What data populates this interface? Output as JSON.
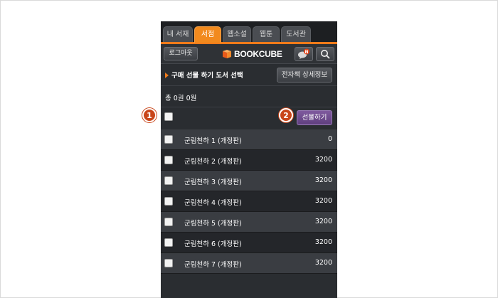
{
  "tabs": [
    {
      "label": "내 서재"
    },
    {
      "label": "서점"
    },
    {
      "label": "웹소설"
    },
    {
      "label": "웹툰"
    },
    {
      "label": "도서관"
    }
  ],
  "header": {
    "logout_label": "로그아웃",
    "logo_text": "BOOKCUBE",
    "notice_badge": "N"
  },
  "select_row": {
    "title": "구매 선물 하기 도서 선택",
    "detail_button": "전자책 상세정보"
  },
  "total": "총 0권 0원",
  "gift_button": "선물하기",
  "callouts": [
    "1",
    "2"
  ],
  "books": [
    {
      "title": "군림천하 1 (개정판)",
      "price": "0"
    },
    {
      "title": "군림천하 2 (개정판)",
      "price": "3200"
    },
    {
      "title": "군림천하 3 (개정판)",
      "price": "3200"
    },
    {
      "title": "군림천하 4 (개정판)",
      "price": "3200"
    },
    {
      "title": "군림천하 5 (개정판)",
      "price": "3200"
    },
    {
      "title": "군림천하 6 (개정판)",
      "price": "3200"
    },
    {
      "title": "군림천하 7 (개정판)",
      "price": "3200"
    }
  ],
  "colors": {
    "accent": "#f07b1a",
    "gift": "#6f4b8e",
    "callout": "#c9461a"
  }
}
